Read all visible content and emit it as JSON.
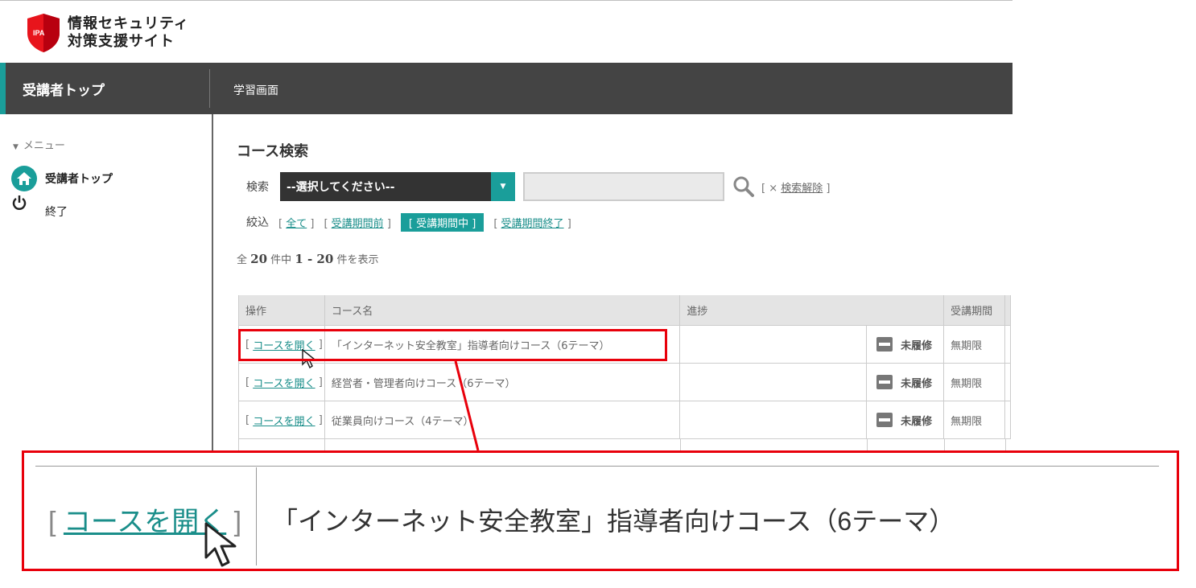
{
  "header": {
    "logo_badge": "IPA",
    "logo_line1": "情報セキュリティ",
    "logo_line2": "対策支援サイト"
  },
  "navbar": {
    "home_label": "受講者トップ",
    "study_label": "学習画面"
  },
  "sidebar": {
    "menu_title": "メニュー",
    "items": [
      {
        "label": "受講者トップ",
        "icon": "home-icon"
      },
      {
        "label": "終了",
        "icon": "power-icon"
      }
    ]
  },
  "main": {
    "title": "コース検索",
    "search": {
      "label": "検索",
      "select_value": "--選択してください--",
      "input_value": "",
      "clear_prefix": "[ × ",
      "clear_label": "検索解除",
      "clear_suffix": " ]"
    },
    "filter": {
      "label": "絞込",
      "all": "全て",
      "before": "受講期間前",
      "during": "[ 受講期間中 ]",
      "after": "受講期間終了"
    },
    "count": {
      "prefix": "全",
      "total": "20",
      "mid": "件中",
      "range": "1 - 20",
      "suffix": "件を表示"
    },
    "table": {
      "headers": [
        "操作",
        "コース名",
        "進捗",
        "受講期間"
      ],
      "rows": [
        {
          "action": "コースを開く",
          "name": "「インターネット安全教室」指導者向けコース（6テーマ）",
          "status": "未履修",
          "period": "無期限"
        },
        {
          "action": "コースを開く",
          "name": "経営者・管理者向けコース（6テーマ）",
          "status": "未履修",
          "period": "無期限"
        },
        {
          "action": "コースを開く",
          "name": "従業員向けコース（4テーマ）",
          "status": "未履修",
          "period": "無期限"
        }
      ]
    }
  },
  "zoom": {
    "action": "コースを開く",
    "name": "「インターネット安全教室」指導者向けコース（6テーマ）"
  },
  "colors": {
    "accent": "#1a9e9a",
    "navbar": "#444444",
    "highlight": "#e8000b"
  }
}
